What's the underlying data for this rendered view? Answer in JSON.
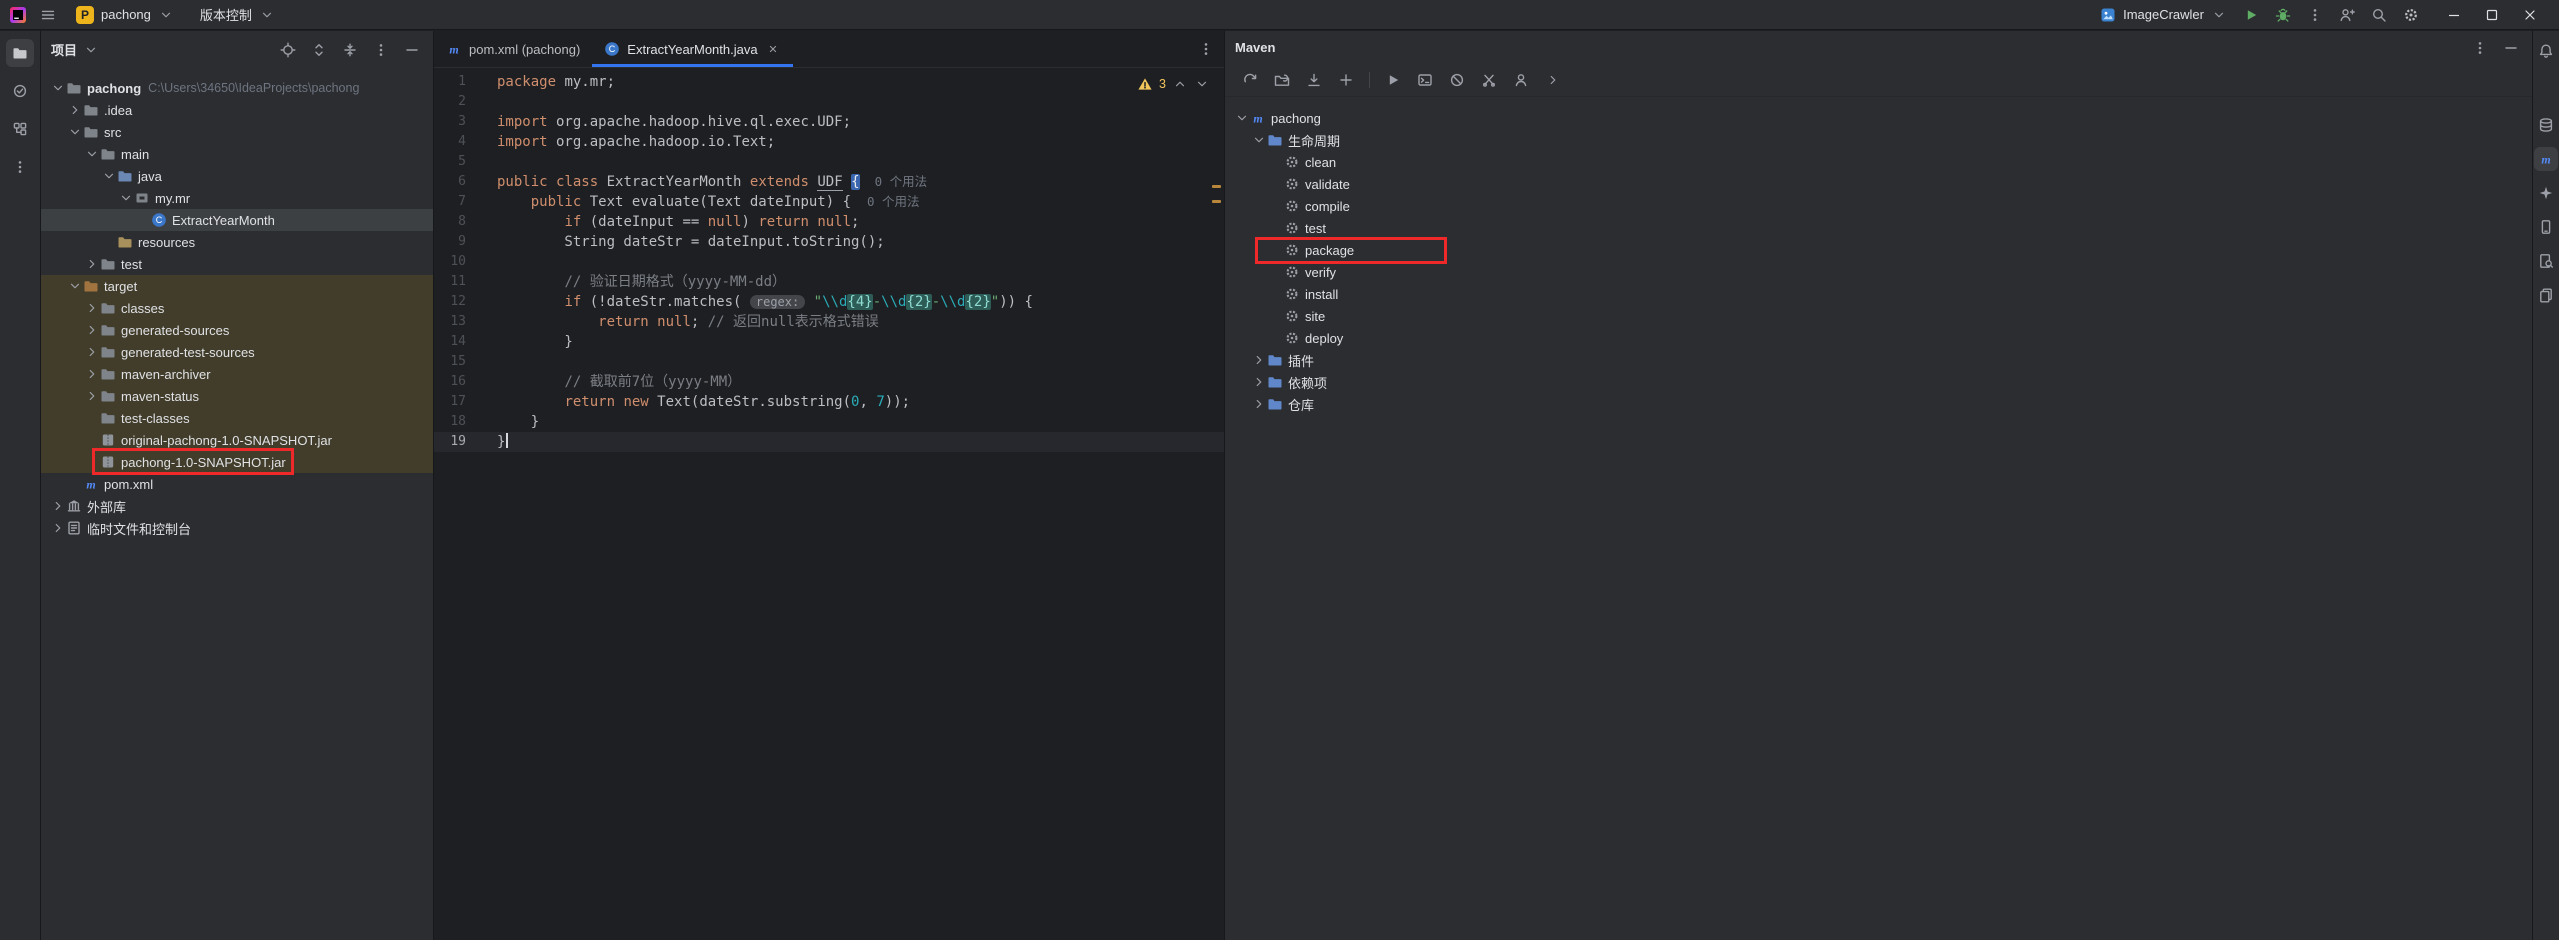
{
  "titlebar": {
    "project_badge": "P",
    "project_name": "pachong",
    "vcs_label": "版本控制",
    "run_config_name": "ImageCrawler"
  },
  "left_strip": {
    "items": [
      {
        "icon": "project",
        "name": "project-tool-window",
        "active": true
      },
      {
        "icon": "commit",
        "name": "commit-tool-window",
        "active": false
      },
      {
        "icon": "structure",
        "name": "structure-tool-window",
        "active": false
      },
      {
        "icon": "more-v",
        "name": "more-tool-windows",
        "active": false
      }
    ]
  },
  "right_strip": {
    "items": [
      {
        "icon": "bell",
        "name": "notifications",
        "active": false
      },
      {
        "icon": "database",
        "name": "database-tool-window",
        "active": false
      },
      {
        "icon": "maven-strip",
        "name": "maven-tool-window",
        "active": true
      },
      {
        "icon": "ai-star",
        "name": "ai-assistant-tool-window",
        "active": false
      },
      {
        "icon": "device",
        "name": "device-explorer-tool-window",
        "active": false
      },
      {
        "icon": "doc-search",
        "name": "find-tool-window",
        "active": false
      },
      {
        "icon": "copy-pages",
        "name": "documentation-tool-window",
        "active": false
      }
    ]
  },
  "project_panel": {
    "title": "项目",
    "header_icons": [
      {
        "icon": "locate",
        "name": "select-opened-file"
      },
      {
        "icon": "updown",
        "name": "expand-collapse"
      },
      {
        "icon": "collapse-all",
        "name": "collapse-all"
      },
      {
        "icon": "more-v",
        "name": "more-options"
      },
      {
        "icon": "minus",
        "name": "hide-panel"
      }
    ],
    "tree": [
      {
        "label": "pachong",
        "hint": "C:\\Users\\34650\\IdeaProjects\\pachong",
        "depth": 0,
        "icon": "folder",
        "state": "expanded",
        "bold": true
      },
      {
        "label": ".idea",
        "depth": 1,
        "icon": "folder",
        "state": "collapsed"
      },
      {
        "label": "src",
        "depth": 1,
        "icon": "folder",
        "state": "expanded"
      },
      {
        "label": "main",
        "depth": 2,
        "icon": "folder",
        "state": "expanded"
      },
      {
        "label": "java",
        "depth": 3,
        "icon": "folder-src",
        "state": "expanded"
      },
      {
        "label": "my.mr",
        "depth": 4,
        "icon": "package",
        "state": "expanded"
      },
      {
        "label": "ExtractYearMonth",
        "depth": 5,
        "icon": "class",
        "state": "none",
        "selected": true
      },
      {
        "label": "resources",
        "depth": 3,
        "icon": "folder-res",
        "state": "none"
      },
      {
        "label": "test",
        "depth": 2,
        "icon": "folder",
        "state": "collapsed"
      },
      {
        "label": "target",
        "depth": 1,
        "icon": "folder-excl",
        "state": "expanded",
        "excluded": true
      },
      {
        "label": "classes",
        "depth": 2,
        "icon": "folder",
        "state": "collapsed",
        "excluded": true
      },
      {
        "label": "generated-sources",
        "depth": 2,
        "icon": "folder",
        "state": "collapsed",
        "excluded": true
      },
      {
        "label": "generated-test-sources",
        "depth": 2,
        "icon": "folder",
        "state": "collapsed",
        "excluded": true
      },
      {
        "label": "maven-archiver",
        "depth": 2,
        "icon": "folder",
        "state": "collapsed",
        "excluded": true
      },
      {
        "label": "maven-status",
        "depth": 2,
        "icon": "folder",
        "state": "collapsed",
        "excluded": true
      },
      {
        "label": "test-classes",
        "depth": 2,
        "icon": "folder",
        "state": "none",
        "excluded": true
      },
      {
        "label": "original-pachong-1.0-SNAPSHOT.jar",
        "depth": 2,
        "icon": "jar",
        "state": "none",
        "excluded": true
      },
      {
        "label": "pachong-1.0-SNAPSHOT.jar",
        "depth": 2,
        "icon": "jar",
        "state": "none",
        "excluded": true,
        "annotated": true
      },
      {
        "label": "pom.xml",
        "depth": 1,
        "icon": "maven",
        "state": "none"
      },
      {
        "label": "外部库",
        "depth": 0,
        "icon": "libraries",
        "state": "collapsed"
      },
      {
        "label": "临时文件和控制台",
        "depth": 0,
        "icon": "scratches",
        "state": "collapsed"
      }
    ]
  },
  "editor": {
    "tabs": [
      {
        "label": "pom.xml (pachong)",
        "icon": "maven",
        "active": false,
        "closable": false
      },
      {
        "label": "ExtractYearMonth.java",
        "icon": "class",
        "active": true,
        "closable": true
      }
    ],
    "inspection": {
      "warning_count": "3"
    },
    "code": {
      "current_line": 19,
      "lines": [
        {
          "n": 1,
          "segs": [
            {
              "c": "kw",
              "t": "package"
            },
            {
              "c": "d",
              "t": " my.mr;"
            }
          ]
        },
        {
          "n": 2,
          "segs": []
        },
        {
          "n": 3,
          "segs": [
            {
              "c": "kw",
              "t": "import"
            },
            {
              "c": "d",
              "t": " org.apache.hadoop.hive.ql.exec.UDF;"
            }
          ]
        },
        {
          "n": 4,
          "segs": [
            {
              "c": "kw",
              "t": "import"
            },
            {
              "c": "d",
              "t": " org.apache.hadoop.io.Text;"
            }
          ]
        },
        {
          "n": 5,
          "segs": []
        },
        {
          "n": 6,
          "segs": [
            {
              "c": "kw",
              "t": "public"
            },
            {
              "c": "d",
              "t": " "
            },
            {
              "c": "kw",
              "t": "class"
            },
            {
              "c": "d",
              "t": " ExtractYearMonth "
            },
            {
              "c": "kw",
              "t": "extends"
            },
            {
              "c": "d",
              "t": " "
            },
            {
              "c": "und",
              "t": "UDF"
            },
            {
              "c": "d",
              "t": " "
            },
            {
              "c": "bhl",
              "t": "{"
            },
            {
              "c": "inlay",
              "t": "  0 个用法"
            }
          ]
        },
        {
          "n": 7,
          "segs": [
            {
              "c": "d",
              "t": "    "
            },
            {
              "c": "kw",
              "t": "public"
            },
            {
              "c": "d",
              "t": " Text evaluate(Text dateInput) { "
            },
            {
              "c": "inlay",
              "t": " 0 个用法"
            }
          ]
        },
        {
          "n": 8,
          "segs": [
            {
              "c": "d",
              "t": "        "
            },
            {
              "c": "kw",
              "t": "if"
            },
            {
              "c": "d",
              "t": " (dateInput == "
            },
            {
              "c": "kw",
              "t": "null"
            },
            {
              "c": "d",
              "t": ") "
            },
            {
              "c": "kw",
              "t": "return"
            },
            {
              "c": "d",
              "t": " "
            },
            {
              "c": "kw",
              "t": "null"
            },
            {
              "c": "d",
              "t": ";"
            }
          ]
        },
        {
          "n": 9,
          "segs": [
            {
              "c": "d",
              "t": "        String dateStr = dateInput.toString();"
            }
          ]
        },
        {
          "n": 10,
          "segs": []
        },
        {
          "n": 11,
          "segs": [
            {
              "c": "d",
              "t": "        "
            },
            {
              "c": "cm",
              "t": "// 验证日期格式（yyyy-MM-dd）"
            }
          ]
        },
        {
          "n": 12,
          "segs": [
            {
              "c": "d",
              "t": "        "
            },
            {
              "c": "kw",
              "t": "if"
            },
            {
              "c": "d",
              "t": " (!dateStr.matches( "
            },
            {
              "c": "itag",
              "t": "regex:"
            },
            {
              "c": "d",
              "t": " "
            },
            {
              "c": "str",
              "t": "\""
            },
            {
              "c": "rx",
              "t": "\\\\d"
            },
            {
              "c": "rxq",
              "t": "{4}"
            },
            {
              "c": "str",
              "t": "-"
            },
            {
              "c": "rx",
              "t": "\\\\d"
            },
            {
              "c": "rxq",
              "t": "{2}"
            },
            {
              "c": "str",
              "t": "-"
            },
            {
              "c": "rx",
              "t": "\\\\d"
            },
            {
              "c": "rxq",
              "t": "{2}"
            },
            {
              "c": "str",
              "t": "\""
            },
            {
              "c": "d",
              "t": ")) {"
            }
          ]
        },
        {
          "n": 13,
          "segs": [
            {
              "c": "d",
              "t": "            "
            },
            {
              "c": "kw",
              "t": "return"
            },
            {
              "c": "d",
              "t": " "
            },
            {
              "c": "kw",
              "t": "null"
            },
            {
              "c": "d",
              "t": "; "
            },
            {
              "c": "cm",
              "t": "// 返回null表示格式错误"
            }
          ]
        },
        {
          "n": 14,
          "segs": [
            {
              "c": "d",
              "t": "        }"
            }
          ]
        },
        {
          "n": 15,
          "segs": []
        },
        {
          "n": 16,
          "segs": [
            {
              "c": "d",
              "t": "        "
            },
            {
              "c": "cm",
              "t": "// 截取前7位（yyyy-MM）"
            }
          ]
        },
        {
          "n": 17,
          "segs": [
            {
              "c": "d",
              "t": "        "
            },
            {
              "c": "kw",
              "t": "return"
            },
            {
              "c": "d",
              "t": " "
            },
            {
              "c": "kw",
              "t": "new"
            },
            {
              "c": "d",
              "t": " Text(dateStr.substring("
            },
            {
              "c": "num",
              "t": "0"
            },
            {
              "c": "d",
              "t": ", "
            },
            {
              "c": "num",
              "t": "7"
            },
            {
              "c": "d",
              "t": "));"
            }
          ]
        },
        {
          "n": 18,
          "segs": [
            {
              "c": "d",
              "t": "    }"
            }
          ]
        },
        {
          "n": 19,
          "segs": [
            {
              "c": "d",
              "t": "}"
            }
          ]
        }
      ]
    }
  },
  "maven_panel": {
    "title": "Maven",
    "header_icons": [
      {
        "icon": "more-v",
        "name": "more-options"
      },
      {
        "icon": "minus",
        "name": "hide-panel"
      }
    ],
    "toolbar_icons": [
      {
        "icon": "sync",
        "name": "reload-all-maven-projects"
      },
      {
        "icon": "gen-sources",
        "name": "generate-sources-and-update-folders"
      },
      {
        "icon": "download",
        "name": "download-sources"
      },
      {
        "icon": "plus",
        "name": "add-maven-project"
      },
      {
        "icon": "sep",
        "name": "separator"
      },
      {
        "icon": "run-gray",
        "name": "run-maven-build"
      },
      {
        "icon": "terminal",
        "name": "execute-maven-goal"
      },
      {
        "icon": "offline",
        "name": "toggle-offline-mode"
      },
      {
        "icon": "skip",
        "name": "skip-tests"
      },
      {
        "icon": "profile",
        "name": "maven-profiles"
      },
      {
        "icon": "chevron-right",
        "name": "more-actions"
      }
    ],
    "tree": [
      {
        "label": "pachong",
        "depth": 0,
        "icon": "maven",
        "state": "expanded"
      },
      {
        "label": "生命周期",
        "depth": 1,
        "icon": "folder-blue",
        "state": "expanded"
      },
      {
        "label": "clean",
        "depth": 2,
        "icon": "goal",
        "state": "none"
      },
      {
        "label": "validate",
        "depth": 2,
        "icon": "goal",
        "state": "none"
      },
      {
        "label": "compile",
        "depth": 2,
        "icon": "goal",
        "state": "none"
      },
      {
        "label": "test",
        "depth": 2,
        "icon": "goal",
        "state": "none"
      },
      {
        "label": "package",
        "depth": 2,
        "icon": "goal",
        "state": "none",
        "annotated": true
      },
      {
        "label": "verify",
        "depth": 2,
        "icon": "goal",
        "state": "none"
      },
      {
        "label": "install",
        "depth": 2,
        "icon": "goal",
        "state": "none"
      },
      {
        "label": "site",
        "depth": 2,
        "icon": "goal",
        "state": "none"
      },
      {
        "label": "deploy",
        "depth": 2,
        "icon": "goal",
        "state": "none"
      },
      {
        "label": "插件",
        "depth": 1,
        "icon": "folder-blue",
        "state": "collapsed"
      },
      {
        "label": "依赖项",
        "depth": 1,
        "icon": "folder-blue",
        "state": "collapsed"
      },
      {
        "label": "仓库",
        "depth": 1,
        "icon": "folder-blue",
        "state": "collapsed"
      }
    ]
  }
}
